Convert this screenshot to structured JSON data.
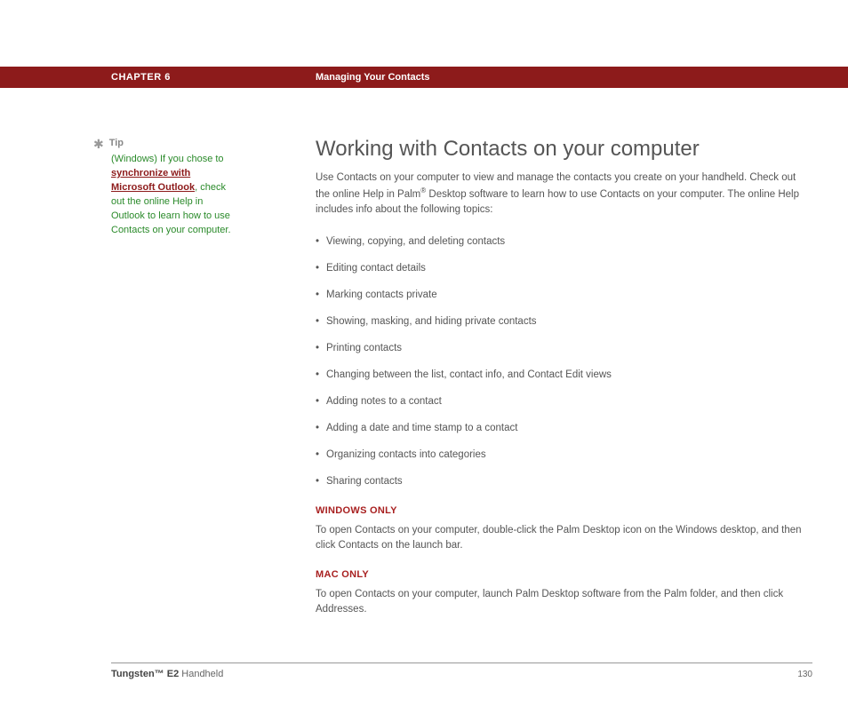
{
  "header": {
    "chapter": "CHAPTER 6",
    "title": "Managing Your Contacts"
  },
  "sidebar": {
    "tip_label": "Tip",
    "tip_before": "(Windows) If you chose to ",
    "tip_link": "synchronize with Microsoft Outlook",
    "tip_after": ", check out the online Help in Outlook to learn how to use Contacts on your computer."
  },
  "main": {
    "heading": "Working with Contacts on your computer",
    "intro_a": "Use Contacts on your computer to view and manage the contacts you create on your handheld. Check out the online Help in Palm",
    "intro_b": " Desktop software to learn how to use Contacts on your computer. The online Help includes info about the following topics:",
    "bullets": [
      "Viewing, copying, and deleting contacts",
      "Editing contact details",
      "Marking contacts private",
      "Showing, masking, and hiding private contacts",
      "Printing contacts",
      "Changing between the list, contact info, and Contact Edit views",
      "Adding notes to a contact",
      "Adding a date and time stamp to a contact",
      "Organizing contacts into categories",
      "Sharing contacts"
    ],
    "windows_label": "WINDOWS ONLY",
    "windows_body": "To open Contacts on your computer, double-click the Palm Desktop icon on the Windows desktop, and then click Contacts on the launch bar.",
    "mac_label": "MAC ONLY",
    "mac_body": "To open Contacts on your computer, launch Palm Desktop software from the Palm folder, and then click Addresses."
  },
  "footer": {
    "product_bold": "Tungsten™ E2",
    "product_rest": " Handheld",
    "page": "130"
  }
}
